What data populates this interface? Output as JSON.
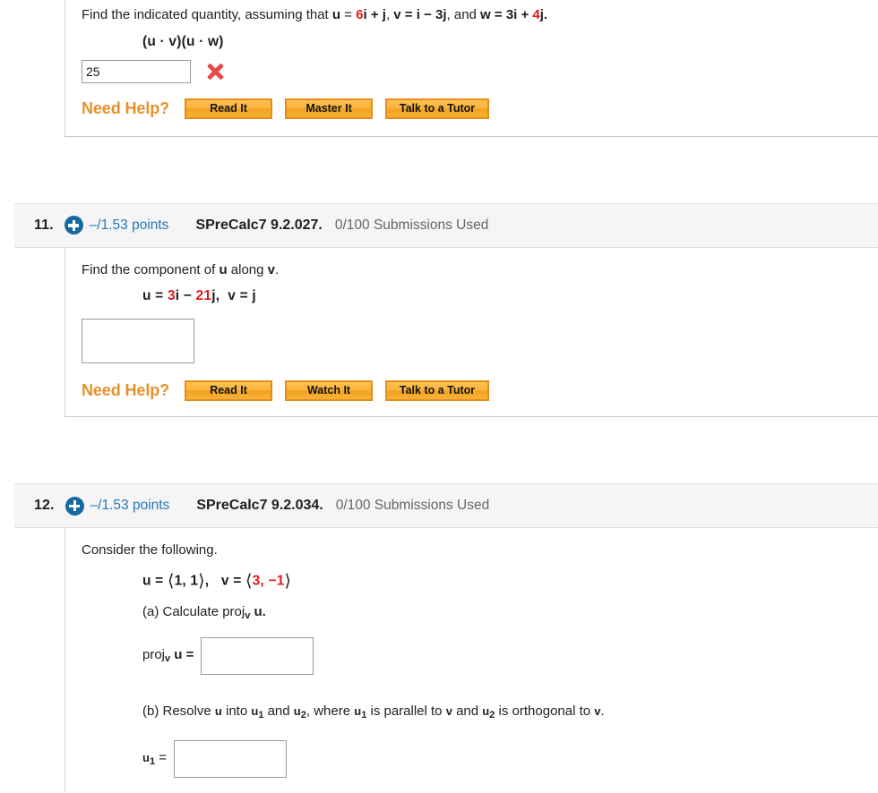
{
  "problems": [
    {
      "number": "",
      "points": "",
      "code": "",
      "submissions": "",
      "prompt_parts": {
        "lead": "Find the indicated quantity, assuming that ",
        "u_label": "u",
        "eq1": " = ",
        "u_val_red": "6",
        "u_val_rest": "i + j",
        "sep1": ", ",
        "v_label": "v",
        "v_val": " = i − 3j",
        "sep2": ", and ",
        "w_label": "w",
        "w_val_pre": " = 3i + ",
        "w_val_red": "4",
        "w_val_post": "j."
      },
      "expression": "(u · v)(u · w)",
      "answer_value": "25",
      "answer_status_icon": "incorrect-x-icon",
      "need_help_label": "Need Help?",
      "buttons": [
        "Read It",
        "Master It",
        "Talk to a Tutor"
      ]
    },
    {
      "number": "11.",
      "points": "–/1.53 points",
      "code": "SPreCalc7 9.2.027.",
      "submissions": "0/100 Submissions Used",
      "prompt": "Find the component of u along v.",
      "prompt_pre": "Find the component of ",
      "prompt_u": "u",
      "prompt_mid": " along ",
      "prompt_v": "v",
      "prompt_end": ".",
      "math": {
        "u_label": "u",
        "eq": " = ",
        "red_a": "3",
        "mid_a": "i − ",
        "red_b": "21",
        "mid_b": "j,",
        "v_label": "v",
        "v_val": " = j"
      },
      "answer_value": "",
      "need_help_label": "Need Help?",
      "buttons": [
        "Read It",
        "Watch It",
        "Talk to a Tutor"
      ]
    },
    {
      "number": "12.",
      "points": "–/1.53 points",
      "code": "SPreCalc7 9.2.034.",
      "submissions": "0/100 Submissions Used",
      "prompt": "Consider the following.",
      "math": {
        "u_label": "u",
        "u_eq": " = ",
        "u_open": "⟨",
        "u_v1": "1, 1",
        "u_close": "⟩",
        "comma": ",",
        "v_label": "v",
        "v_eq": " = ",
        "v_open": "⟨",
        "v_red": "3, −1",
        "v_close": "⟩"
      },
      "part_a": {
        "text_pre": "(a) Calculate proj",
        "sub_v": "v",
        "text_post": " u.",
        "label_pre": "proj",
        "label_sub": "v",
        "label_post": " u  =",
        "answer_value": ""
      },
      "part_b": {
        "text": "(b) Resolve u into u1 and u2, where u1 is parallel to v and u2 is orthogonal to v.",
        "seg1": "(b) Resolve ",
        "u": "u",
        "seg2": " into ",
        "u1": "u",
        "sub1": "1",
        "seg3": " and ",
        "u2": "u",
        "sub2": "2",
        "seg4": ", where ",
        "u1b": "u",
        "sub1b": "1",
        "seg5": " is parallel to ",
        "v1": "v",
        "seg6": " and ",
        "u2b": "u",
        "sub2b": "2",
        "seg7": " is orthogonal to ",
        "v2": "v",
        "seg8": ".",
        "label_u": "u",
        "label_sub": "1",
        "label_eq": " =",
        "answer_value": ""
      }
    }
  ],
  "colors": {
    "accent_blue": "#2678b7",
    "icon_blue": "#16699f",
    "red_value": "#e01b1b",
    "need_help_orange": "#e8912b",
    "header_bg": "#f5f5f5",
    "incorrect_red": "#e8494a"
  }
}
